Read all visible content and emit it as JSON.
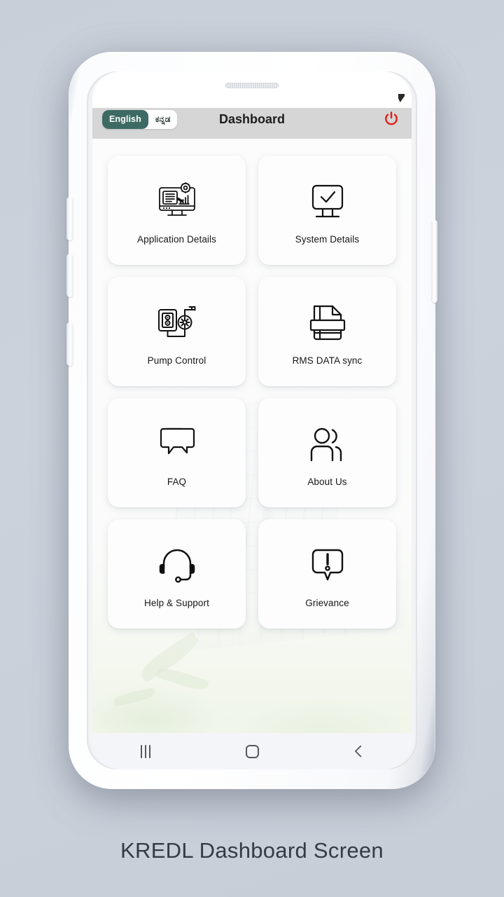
{
  "caption": "KREDL Dashboard Screen",
  "phone": {
    "frame_color": "#ffffff",
    "speaker_name": "earpiece-speaker"
  },
  "app": {
    "header": {
      "title": "Dashboard",
      "header_bg": "#d6d6d6",
      "language_toggle": {
        "active": "English",
        "options": [
          {
            "label": "English",
            "active": true
          },
          {
            "label": "ಕನ್ನಡ",
            "active": false
          }
        ],
        "active_bg": "#3d6b63"
      },
      "power_button": {
        "name": "power-logout-icon",
        "color": "#e0231f"
      }
    },
    "grid": {
      "cards": [
        {
          "label": "Application Details",
          "icon": "monitor-document-gear-chart-icon"
        },
        {
          "label": "System Details",
          "icon": "monitor-check-icon"
        },
        {
          "label": "Pump Control",
          "icon": "pump-controller-icon"
        },
        {
          "label": "RMS DATA sync",
          "icon": "document-sync-icon"
        },
        {
          "label": "FAQ",
          "icon": "chat-bubbles-icon"
        },
        {
          "label": "About Us",
          "icon": "people-group-icon"
        },
        {
          "label": "Help & Support",
          "icon": "headset-icon"
        },
        {
          "label": "Grievance",
          "icon": "exclamation-bubble-icon"
        }
      ]
    },
    "navbar": {
      "items": [
        {
          "name": "recents",
          "icon": "recents-icon"
        },
        {
          "name": "home",
          "icon": "home-square-icon"
        },
        {
          "name": "back",
          "icon": "back-chevron-icon"
        }
      ]
    }
  }
}
